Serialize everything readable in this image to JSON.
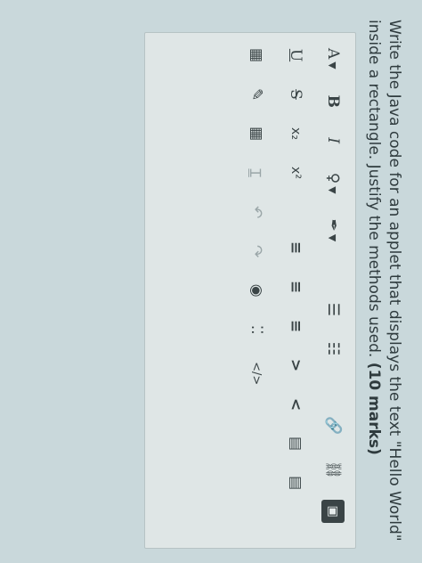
{
  "question": {
    "text": "Write the Java code for an applet that displays the text \"Hello World\" inside a rectangle. Justify the methods used.",
    "marks": "(10 marks)"
  },
  "toolbar": {
    "row1": [
      {
        "label": "A",
        "icon": "font-style-icon",
        "dropdown": true
      },
      {
        "label": "B",
        "icon": "bold-icon"
      },
      {
        "label": "I",
        "icon": "italic-icon"
      },
      {
        "label": "♀",
        "icon": "text-color-icon",
        "dropdown": true
      },
      {
        "label": "✒",
        "icon": "highlight-icon",
        "dropdown": true
      },
      {
        "label": "☰",
        "icon": "bulleted-list-icon"
      },
      {
        "label": "☷",
        "icon": "numbered-list-icon"
      },
      {
        "label": "🔗",
        "icon": "link-icon"
      },
      {
        "label": "⛓",
        "icon": "unlink-icon"
      },
      {
        "label": "▣",
        "icon": "image-icon"
      }
    ],
    "row2": [
      {
        "label": "U",
        "icon": "underline-icon"
      },
      {
        "label": "S",
        "icon": "strikethrough-icon"
      },
      {
        "label": "x₂",
        "icon": "subscript-icon"
      },
      {
        "label": "x²",
        "icon": "superscript-icon"
      },
      {
        "label": "≡",
        "icon": "align-left-icon"
      },
      {
        "label": "≡",
        "icon": "align-center-icon"
      },
      {
        "label": "≡",
        "icon": "align-right-icon"
      },
      {
        "label": ">",
        "icon": "indent-icon"
      },
      {
        "label": "<",
        "icon": "outdent-icon"
      },
      {
        "label": "▤",
        "icon": "blockquote-icon"
      },
      {
        "label": "▤",
        "icon": "justify-icon"
      }
    ],
    "row3": [
      {
        "label": "▦",
        "icon": "table-icon"
      },
      {
        "label": "✎",
        "icon": "edit-icon"
      },
      {
        "label": "▦",
        "icon": "table-grid-icon"
      },
      {
        "label": "Ɪ",
        "icon": "clear-format-icon"
      },
      {
        "label": "↶",
        "icon": "undo-icon"
      },
      {
        "label": "↷",
        "icon": "redo-icon"
      },
      {
        "label": "◉",
        "icon": "accessibility-icon"
      },
      {
        "label": "⁚⁚",
        "icon": "more-icon"
      },
      {
        "label": "</>",
        "icon": "source-code-icon"
      }
    ]
  }
}
